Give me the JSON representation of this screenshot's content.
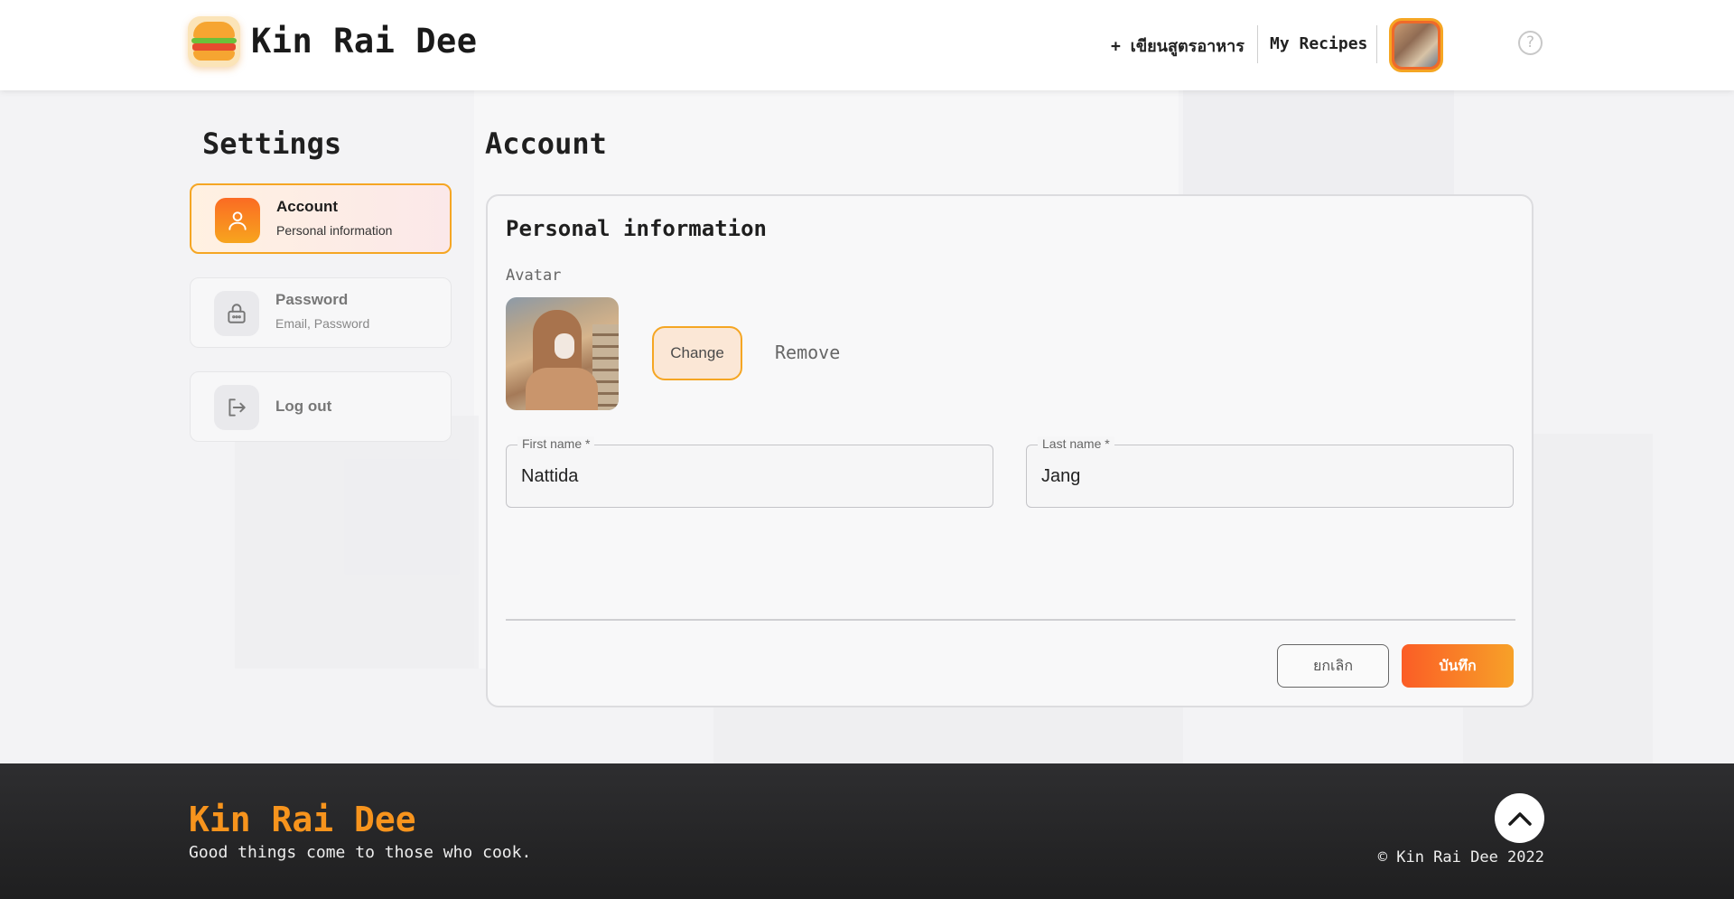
{
  "header": {
    "brand": "Kin Rai Dee",
    "write_recipe": "+ เขียนสูตรอาหาร",
    "my_recipes": "My Recipes",
    "help": "?"
  },
  "sidebar": {
    "title": "Settings",
    "items": [
      {
        "label": "Account",
        "sub": "Personal information",
        "icon": "user-icon",
        "active": true
      },
      {
        "label": "Password",
        "sub": "Email, Password",
        "icon": "lock-icon",
        "active": false
      },
      {
        "label": "Log out",
        "sub": "",
        "icon": "logout-icon",
        "active": false
      }
    ]
  },
  "main": {
    "title": "Account",
    "section_heading": "Personal information",
    "avatar_label": "Avatar",
    "change_label": "Change",
    "remove_label": "Remove",
    "first_name": {
      "label": "First name *",
      "value": "Nattida"
    },
    "last_name": {
      "label": "Last name *",
      "value": "Jang"
    },
    "cancel_label": "ยกเลิก",
    "save_label": "บันทึก"
  },
  "footer": {
    "brand": "Kin Rai Dee",
    "tagline": "Good things come to those who cook.",
    "copyright": "© Kin Rai Dee 2022"
  },
  "colors": {
    "accent_orange": "#f7941d",
    "accent_gradient_start": "#fb5d26",
    "accent_gradient_end": "#f7a128",
    "active_border": "#f5a623",
    "footer_bg": "#2a2a2b"
  }
}
